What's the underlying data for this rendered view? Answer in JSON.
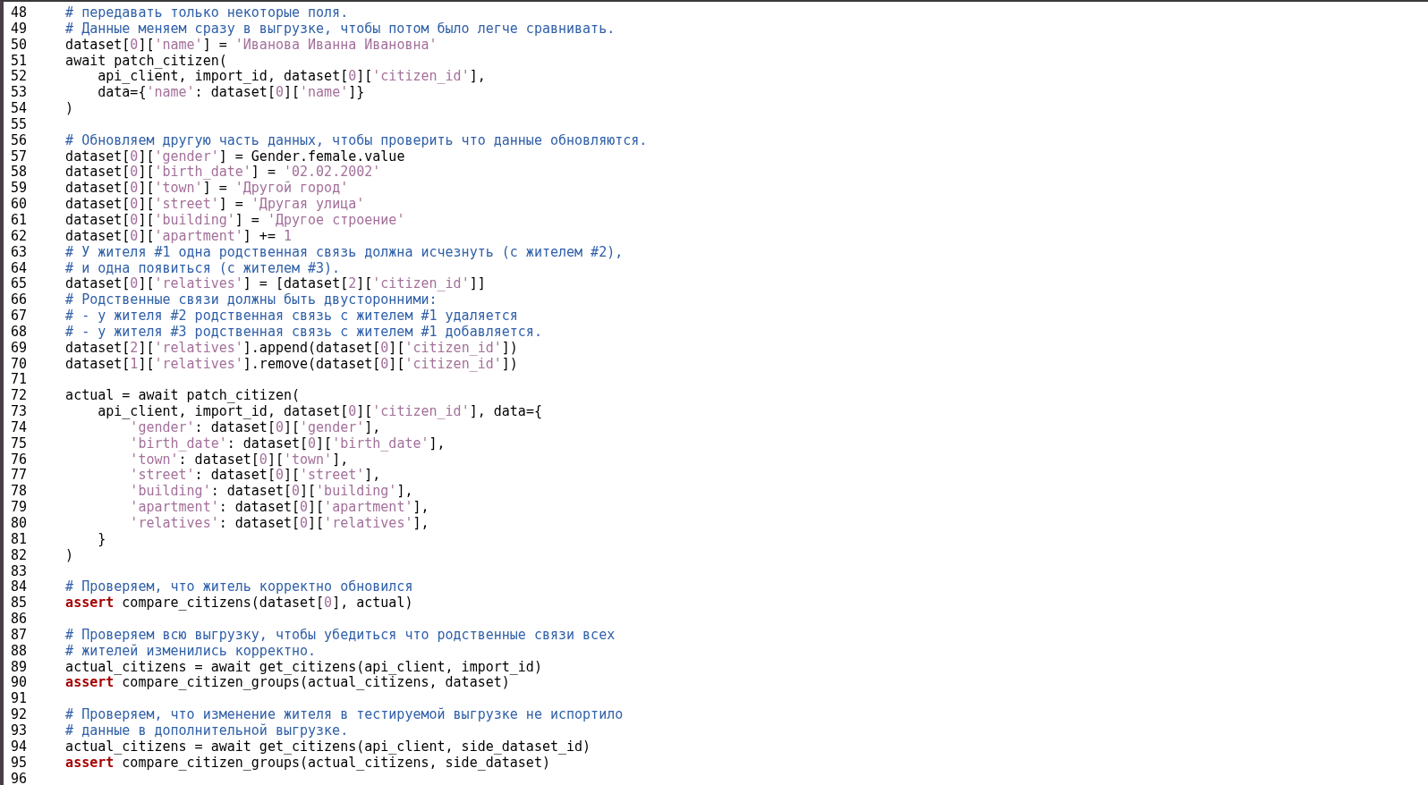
{
  "editor": {
    "lines": [
      {
        "number": "48",
        "tokens": [
          {
            "kind": "comment",
            "text": "# передавать только некоторые поля."
          }
        ]
      },
      {
        "number": "49",
        "tokens": [
          {
            "kind": "comment",
            "text": "# Данные меняем сразу в выгрузке, чтобы потом было легче сравнивать."
          }
        ]
      },
      {
        "number": "50",
        "tokens": [
          {
            "kind": "plain",
            "text": "dataset["
          },
          {
            "kind": "number",
            "text": "0"
          },
          {
            "kind": "plain",
            "text": "]["
          },
          {
            "kind": "string",
            "text": "'name'"
          },
          {
            "kind": "plain",
            "text": "] = "
          },
          {
            "kind": "string",
            "text": "'Иванова Иванна Ивановна'"
          }
        ]
      },
      {
        "number": "51",
        "tokens": [
          {
            "kind": "plain",
            "text": "await patch_citizen("
          }
        ],
        "children": [
          {
            "number": "52",
            "tokens": [
              {
                "kind": "plain",
                "text": "api_client, import_id, dataset["
              },
              {
                "kind": "number",
                "text": "0"
              },
              {
                "kind": "plain",
                "text": "]["
              },
              {
                "kind": "string",
                "text": "'citizen_id'"
              },
              {
                "kind": "plain",
                "text": "],"
              }
            ]
          },
          {
            "number": "53",
            "tokens": [
              {
                "kind": "plain",
                "text": "data={"
              },
              {
                "kind": "string",
                "text": "'name'"
              },
              {
                "kind": "plain",
                "text": ": dataset["
              },
              {
                "kind": "number",
                "text": "0"
              },
              {
                "kind": "plain",
                "text": "]["
              },
              {
                "kind": "string",
                "text": "'name'"
              },
              {
                "kind": "plain",
                "text": "]}"
              }
            ]
          }
        ]
      },
      {
        "number": "54",
        "tokens": [
          {
            "kind": "plain",
            "text": ")"
          }
        ]
      },
      {
        "number": "55"
      },
      {
        "number": "56",
        "tokens": [
          {
            "kind": "comment",
            "text": "# Обновляем другую часть данных, чтобы проверить что данные обновляются."
          }
        ]
      },
      {
        "number": "57",
        "tokens": [
          {
            "kind": "plain",
            "text": "dataset["
          },
          {
            "kind": "number",
            "text": "0"
          },
          {
            "kind": "plain",
            "text": "]["
          },
          {
            "kind": "string",
            "text": "'gender'"
          },
          {
            "kind": "plain",
            "text": "] = Gender.female.value"
          }
        ]
      },
      {
        "number": "58",
        "tokens": [
          {
            "kind": "plain",
            "text": "dataset["
          },
          {
            "kind": "number",
            "text": "0"
          },
          {
            "kind": "plain",
            "text": "]["
          },
          {
            "kind": "string",
            "text": "'birth_date'"
          },
          {
            "kind": "plain",
            "text": "] = "
          },
          {
            "kind": "string",
            "text": "'02.02.2002'"
          }
        ]
      },
      {
        "number": "59",
        "tokens": [
          {
            "kind": "plain",
            "text": "dataset["
          },
          {
            "kind": "number",
            "text": "0"
          },
          {
            "kind": "plain",
            "text": "]["
          },
          {
            "kind": "string",
            "text": "'town'"
          },
          {
            "kind": "plain",
            "text": "] = "
          },
          {
            "kind": "string",
            "text": "'Другой город'"
          }
        ]
      },
      {
        "number": "60",
        "tokens": [
          {
            "kind": "plain",
            "text": "dataset["
          },
          {
            "kind": "number",
            "text": "0"
          },
          {
            "kind": "plain",
            "text": "]["
          },
          {
            "kind": "string",
            "text": "'street'"
          },
          {
            "kind": "plain",
            "text": "] = "
          },
          {
            "kind": "string",
            "text": "'Другая улица'"
          }
        ]
      },
      {
        "number": "61",
        "tokens": [
          {
            "kind": "plain",
            "text": "dataset["
          },
          {
            "kind": "number",
            "text": "0"
          },
          {
            "kind": "plain",
            "text": "]["
          },
          {
            "kind": "string",
            "text": "'building'"
          },
          {
            "kind": "plain",
            "text": "] = "
          },
          {
            "kind": "string",
            "text": "'Другое строение'"
          }
        ]
      },
      {
        "number": "62",
        "tokens": [
          {
            "kind": "plain",
            "text": "dataset["
          },
          {
            "kind": "number",
            "text": "0"
          },
          {
            "kind": "plain",
            "text": "]["
          },
          {
            "kind": "string",
            "text": "'apartment'"
          },
          {
            "kind": "plain",
            "text": "] += "
          },
          {
            "kind": "number",
            "text": "1"
          }
        ]
      },
      {
        "number": "63",
        "tokens": [
          {
            "kind": "comment",
            "text": "# У жителя #1 одна родственная связь должна исчезнуть (с жителем #2),"
          }
        ]
      },
      {
        "number": "64",
        "tokens": [
          {
            "kind": "comment",
            "text": "# и одна появиться (с жителем #3)."
          }
        ]
      },
      {
        "number": "65",
        "tokens": [
          {
            "kind": "plain",
            "text": "dataset["
          },
          {
            "kind": "number",
            "text": "0"
          },
          {
            "kind": "plain",
            "text": "]["
          },
          {
            "kind": "string",
            "text": "'relatives'"
          },
          {
            "kind": "plain",
            "text": "] = [dataset["
          },
          {
            "kind": "number",
            "text": "2"
          },
          {
            "kind": "plain",
            "text": "]["
          },
          {
            "kind": "string",
            "text": "'citizen_id'"
          },
          {
            "kind": "plain",
            "text": "]]"
          }
        ]
      },
      {
        "number": "66",
        "tokens": [
          {
            "kind": "comment",
            "text": "# Родственные связи должны быть двусторонними:"
          }
        ]
      },
      {
        "number": "67",
        "tokens": [
          {
            "kind": "comment",
            "text": "# - у жителя #2 родственная связь с жителем #1 удаляется"
          }
        ]
      },
      {
        "number": "68",
        "tokens": [
          {
            "kind": "comment",
            "text": "# - у жителя #3 родственная связь с жителем #1 добавляется."
          }
        ]
      },
      {
        "number": "69",
        "tokens": [
          {
            "kind": "plain",
            "text": "dataset["
          },
          {
            "kind": "number",
            "text": "2"
          },
          {
            "kind": "plain",
            "text": "]["
          },
          {
            "kind": "string",
            "text": "'relatives'"
          },
          {
            "kind": "plain",
            "text": "].append(dataset["
          },
          {
            "kind": "number",
            "text": "0"
          },
          {
            "kind": "plain",
            "text": "]["
          },
          {
            "kind": "string",
            "text": "'citizen_id'"
          },
          {
            "kind": "plain",
            "text": "])"
          }
        ]
      },
      {
        "number": "70",
        "tokens": [
          {
            "kind": "plain",
            "text": "dataset["
          },
          {
            "kind": "number",
            "text": "1"
          },
          {
            "kind": "plain",
            "text": "]["
          },
          {
            "kind": "string",
            "text": "'relatives'"
          },
          {
            "kind": "plain",
            "text": "].remove(dataset["
          },
          {
            "kind": "number",
            "text": "0"
          },
          {
            "kind": "plain",
            "text": "]["
          },
          {
            "kind": "string",
            "text": "'citizen_id'"
          },
          {
            "kind": "plain",
            "text": "])"
          }
        ]
      },
      {
        "number": "71"
      },
      {
        "number": "72",
        "tokens": [
          {
            "kind": "plain",
            "text": "actual = await patch_citizen("
          }
        ],
        "children": [
          {
            "number": "73",
            "tokens": [
              {
                "kind": "plain",
                "text": "api_client, import_id, dataset["
              },
              {
                "kind": "number",
                "text": "0"
              },
              {
                "kind": "plain",
                "text": "]["
              },
              {
                "kind": "string",
                "text": "'citizen_id'"
              },
              {
                "kind": "plain",
                "text": "], data={"
              }
            ],
            "children": [
              {
                "number": "74",
                "tokens": [
                  {
                    "kind": "string",
                    "text": "'gender'"
                  },
                  {
                    "kind": "plain",
                    "text": ": dataset["
                  },
                  {
                    "kind": "number",
                    "text": "0"
                  },
                  {
                    "kind": "plain",
                    "text": "]["
                  },
                  {
                    "kind": "string",
                    "text": "'gender'"
                  },
                  {
                    "kind": "plain",
                    "text": "],"
                  }
                ]
              },
              {
                "number": "75",
                "tokens": [
                  {
                    "kind": "string",
                    "text": "'birth_date'"
                  },
                  {
                    "kind": "plain",
                    "text": ": dataset["
                  },
                  {
                    "kind": "number",
                    "text": "0"
                  },
                  {
                    "kind": "plain",
                    "text": "]["
                  },
                  {
                    "kind": "string",
                    "text": "'birth_date'"
                  },
                  {
                    "kind": "plain",
                    "text": "],"
                  }
                ]
              },
              {
                "number": "76",
                "tokens": [
                  {
                    "kind": "string",
                    "text": "'town'"
                  },
                  {
                    "kind": "plain",
                    "text": ": dataset["
                  },
                  {
                    "kind": "number",
                    "text": "0"
                  },
                  {
                    "kind": "plain",
                    "text": "]["
                  },
                  {
                    "kind": "string",
                    "text": "'town'"
                  },
                  {
                    "kind": "plain",
                    "text": "],"
                  }
                ]
              },
              {
                "number": "77",
                "tokens": [
                  {
                    "kind": "string",
                    "text": "'street'"
                  },
                  {
                    "kind": "plain",
                    "text": ": dataset["
                  },
                  {
                    "kind": "number",
                    "text": "0"
                  },
                  {
                    "kind": "plain",
                    "text": "]["
                  },
                  {
                    "kind": "string",
                    "text": "'street'"
                  },
                  {
                    "kind": "plain",
                    "text": "],"
                  }
                ]
              },
              {
                "number": "78",
                "tokens": [
                  {
                    "kind": "string",
                    "text": "'building'"
                  },
                  {
                    "kind": "plain",
                    "text": ": dataset["
                  },
                  {
                    "kind": "number",
                    "text": "0"
                  },
                  {
                    "kind": "plain",
                    "text": "]["
                  },
                  {
                    "kind": "string",
                    "text": "'building'"
                  },
                  {
                    "kind": "plain",
                    "text": "],"
                  }
                ]
              },
              {
                "number": "79",
                "tokens": [
                  {
                    "kind": "string",
                    "text": "'apartment'"
                  },
                  {
                    "kind": "plain",
                    "text": ": dataset["
                  },
                  {
                    "kind": "number",
                    "text": "0"
                  },
                  {
                    "kind": "plain",
                    "text": "]["
                  },
                  {
                    "kind": "string",
                    "text": "'apartment'"
                  },
                  {
                    "kind": "plain",
                    "text": "],"
                  }
                ]
              },
              {
                "number": "80",
                "tokens": [
                  {
                    "kind": "string",
                    "text": "'relatives'"
                  },
                  {
                    "kind": "plain",
                    "text": ": dataset["
                  },
                  {
                    "kind": "number",
                    "text": "0"
                  },
                  {
                    "kind": "plain",
                    "text": "]["
                  },
                  {
                    "kind": "string",
                    "text": "'relatives'"
                  },
                  {
                    "kind": "plain",
                    "text": "],"
                  }
                ]
              }
            ]
          },
          {
            "number": "81",
            "tokens": [
              {
                "kind": "plain",
                "text": "}"
              }
            ]
          }
        ]
      },
      {
        "number": "82",
        "tokens": [
          {
            "kind": "plain",
            "text": ")"
          }
        ]
      },
      {
        "number": "83"
      },
      {
        "number": "84",
        "tokens": [
          {
            "kind": "comment",
            "text": "# Проверяем, что житель корректно обновился"
          }
        ]
      },
      {
        "number": "85",
        "tokens": [
          {
            "kind": "keyword",
            "text": "assert"
          },
          {
            "kind": "plain",
            "text": " compare_citizens(dataset["
          },
          {
            "kind": "number",
            "text": "0"
          },
          {
            "kind": "plain",
            "text": "], actual)"
          }
        ]
      },
      {
        "number": "86"
      },
      {
        "number": "87",
        "tokens": [
          {
            "kind": "comment",
            "text": "# Проверяем всю выгрузку, чтобы убедиться что родственные связи всех"
          }
        ]
      },
      {
        "number": "88",
        "tokens": [
          {
            "kind": "comment",
            "text": "# жителей изменились корректно."
          }
        ]
      },
      {
        "number": "89",
        "tokens": [
          {
            "kind": "plain",
            "text": "actual_citizens = await get_citizens(api_client, import_id)"
          }
        ]
      },
      {
        "number": "90",
        "tokens": [
          {
            "kind": "keyword",
            "text": "assert"
          },
          {
            "kind": "plain",
            "text": " compare_citizen_groups(actual_citizens, dataset)"
          }
        ]
      },
      {
        "number": "91"
      },
      {
        "number": "92",
        "tokens": [
          {
            "kind": "comment",
            "text": "# Проверяем, что изменение жителя в тестируемой выгрузке не испортило"
          }
        ]
      },
      {
        "number": "93",
        "tokens": [
          {
            "kind": "comment",
            "text": "# данные в дополнительной выгрузке."
          }
        ]
      },
      {
        "number": "94",
        "tokens": [
          {
            "kind": "plain",
            "text": "actual_citizens = await get_citizens(api_client, side_dataset_id)"
          }
        ]
      },
      {
        "number": "95",
        "tokens": [
          {
            "kind": "keyword",
            "text": "assert"
          },
          {
            "kind": "plain",
            "text": " compare_citizen_groups(actual_citizens, side_dataset)"
          }
        ]
      },
      {
        "number": "96"
      }
    ]
  }
}
